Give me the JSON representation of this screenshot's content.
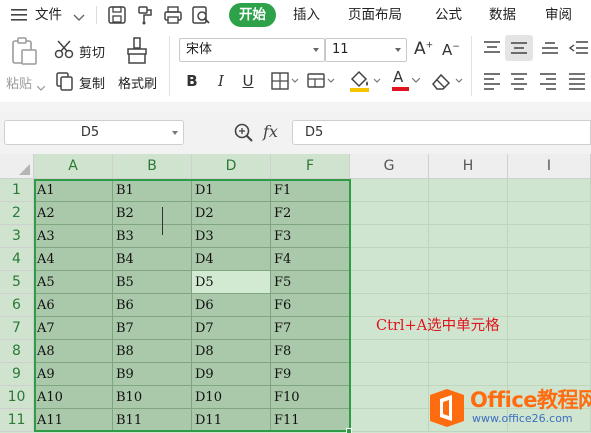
{
  "menu": {
    "file_label": "文件",
    "tabs": [
      {
        "label": "开始"
      },
      {
        "label": "插入"
      },
      {
        "label": "页面布局"
      },
      {
        "label": "公式"
      },
      {
        "label": "数据"
      },
      {
        "label": "审阅"
      }
    ],
    "quick_icons": [
      "save-icon",
      "format-painter-quick-icon",
      "print-icon",
      "print-preview-icon"
    ]
  },
  "ribbon": {
    "paste_label": "粘贴",
    "cut_label": "剪切",
    "copy_label": "复制",
    "format_painter_label": "格式刷",
    "font_name": "宋体",
    "font_size": "11",
    "bold_label": "B",
    "italic_label": "I",
    "underline_label": "U",
    "font_color_label": "A",
    "increase_font_label": "A",
    "decrease_font_label": "A"
  },
  "formula_bar": {
    "name_box": "D5",
    "zoom_icon": "zoom-icon",
    "fx_label": "fx",
    "formula_value": "D5"
  },
  "sheet": {
    "columns": [
      "A",
      "B",
      "D",
      "F",
      "G",
      "H",
      "I"
    ],
    "rows": [
      "1",
      "2",
      "3",
      "4",
      "5",
      "6",
      "7",
      "8",
      "9",
      "10",
      "11"
    ],
    "cells": [
      [
        "A1",
        "B1",
        "D1",
        "F1"
      ],
      [
        "A2",
        "B2",
        "D2",
        "F2"
      ],
      [
        "A3",
        "B3",
        "D3",
        "F3"
      ],
      [
        "A4",
        "B4",
        "D4",
        "F4"
      ],
      [
        "A5",
        "B5",
        "D5",
        "F5"
      ],
      [
        "A6",
        "B6",
        "D6",
        "F6"
      ],
      [
        "A7",
        "B7",
        "D7",
        "F7"
      ],
      [
        "A8",
        "B8",
        "D8",
        "F8"
      ],
      [
        "A9",
        "B9",
        "D9",
        "F9"
      ],
      [
        "A10",
        "B10",
        "D10",
        "F10"
      ],
      [
        "A11",
        "B11",
        "D11",
        "F11"
      ]
    ],
    "active_cell": "D5",
    "annotation": "Ctrl+A选中单元格",
    "selection_color": "#2e9c45"
  },
  "watermark": {
    "title": "Office教程网",
    "url": "www.office26.com"
  },
  "colors": {
    "accent_green": "#2ea24a",
    "annotation_red": "#e0141e",
    "watermark_orange": "#ff6c10",
    "watermark_blue": "#3d6fc0"
  }
}
